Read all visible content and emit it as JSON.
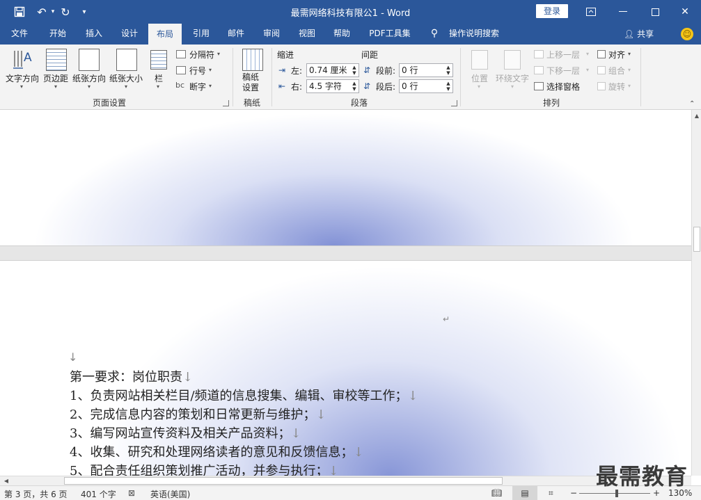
{
  "titlebar": {
    "title": "最需网络科技有限公1 - Word",
    "login": "登录"
  },
  "tabs": [
    "文件",
    "开始",
    "插入",
    "设计",
    "布局",
    "引用",
    "邮件",
    "审阅",
    "视图",
    "帮助",
    "PDF工具集",
    "操作说明搜索"
  ],
  "active_tab": "布局",
  "share": "共享",
  "ribbon": {
    "page_setup": {
      "text_direction": "文字方向",
      "margins": "页边距",
      "orientation": "纸张方向",
      "size": "纸张大小",
      "columns": "栏",
      "breaks": "分隔符",
      "line_numbers": "行号",
      "hyphenation": "断字",
      "label": "页面设置"
    },
    "manuscript": {
      "setup": "稿纸设置",
      "label": "稿纸"
    },
    "paragraph": {
      "indent_title": "缩进",
      "spacing_title": "间距",
      "left_label": "左:",
      "left_value": "0.74 厘米",
      "right_label": "右:",
      "right_value": "4.5 字符",
      "before_label": "段前:",
      "before_value": "0 行",
      "after_label": "段后:",
      "after_value": "0 行",
      "label": "段落"
    },
    "arrange": {
      "position": "位置",
      "wrap_text": "环绕文字",
      "bring_forward": "上移一层",
      "send_backward": "下移一层",
      "selection_pane": "选择窗格",
      "align": "对齐",
      "group": "组合",
      "rotate": "旋转",
      "label": "排列"
    }
  },
  "document": {
    "lines": [
      "第一要求：岗位职责",
      "1、负责网站相关栏目/频道的信息搜集、编辑、审校等工作；",
      "2、完成信息内容的策划和日常更新与维护；",
      "3、编写网站宣传资料及相关产品资料；",
      "4、收集、研究和处理网络读者的意见和反馈信息；",
      "5、配合责任组织策划推广活动，并参与执行；"
    ],
    "para_mark": "↵",
    "line_mark": "↓"
  },
  "status": {
    "page": "第 3 页，共 6 页",
    "words": "401 个字",
    "language": "英语(美国)",
    "zoom": "130%"
  },
  "watermark": "最需教育"
}
